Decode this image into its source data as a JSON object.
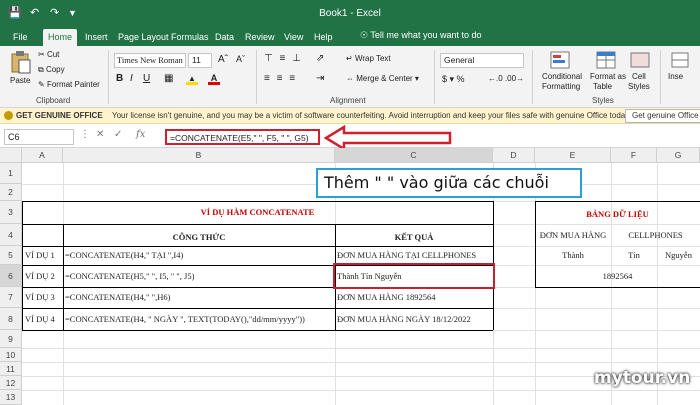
{
  "window": {
    "title": "Book1 - Excel"
  },
  "tabs": [
    "File",
    "Home",
    "Insert",
    "Page Layout",
    "Formulas",
    "Data",
    "Review",
    "View",
    "Help"
  ],
  "tell_me": "Tell me what you want to do",
  "ribbon": {
    "clipboard": {
      "paste": "Paste",
      "cut": "Cut",
      "copy": "Copy",
      "format_painter": "Format Painter",
      "label": "Clipboard"
    },
    "font": {
      "name": "Times New Roman",
      "size": "11",
      "bold": "B",
      "italic": "I",
      "underline": "U"
    },
    "alignment": {
      "wrap_text": "Wrap Text",
      "merge_center": "Merge & Center",
      "label": "Alignment"
    },
    "number": {
      "format": "General"
    },
    "styles": {
      "conditional": "Conditional",
      "formatting": "Formatting",
      "format_as": "Format as",
      "table": "Table",
      "cell": "Cell",
      "cell_styles": "Styles",
      "label": "Styles"
    },
    "cells": {
      "insert": "Inse",
      "label": ""
    }
  },
  "license_bar": {
    "title": "GET GENUINE OFFICE",
    "message": "Your license isn't genuine, and you may be a victim of software counterfeiting. Avoid interruption and keep your files safe with genuine Office today.",
    "button": "Get genuine Office"
  },
  "formula_bar": {
    "name_box": "C6",
    "fx": "fx",
    "formula": "=CONCATENATE(E5,\" \", F5, \" \", G5)"
  },
  "columns": [
    "A",
    "B",
    "C",
    "D",
    "E",
    "F",
    "G"
  ],
  "rows": [
    "1",
    "2",
    "3",
    "4",
    "5",
    "6",
    "7",
    "8",
    "9",
    "10",
    "11",
    "12",
    "13"
  ],
  "callout": "Thêm \" \" vào giữa các chuỗi",
  "sheet": {
    "main_title": "VÍ DỤ HÀM CONCATENATE",
    "header_formula": "CÔNG THỨC",
    "header_result": "KẾT QUẢ",
    "examples": [
      {
        "label": "VÍ DỤ 1",
        "formula": "=CONCATENATE(H4,\" TẠI \",I4)",
        "result": "ĐƠN MUA HÀNG TẠI CELLPHONES"
      },
      {
        "label": "VÍ DỤ 2",
        "formula": "=CONCATENATE(H5,\" \", I5, \" \", J5)",
        "result": "Thành Tín Nguyễn"
      },
      {
        "label": "VÍ DỤ 3",
        "formula": "=CONCATENATE(H4,\" \",H6)",
        "result": "ĐƠN MUA HÀNG 1892564"
      },
      {
        "label": "VÍ DỤ 4",
        "formula": "=CONCATENATE(H4, \" NGÀY \", TEXT(TODAY(),\"dd/mm/yyyy\"))",
        "result": "ĐƠN MUA HÀNG NGÀY 18/12/2022"
      }
    ],
    "data_table": {
      "title": "BẢNG DỮ LIỆU",
      "h1": "ĐƠN MUA HÀNG",
      "h2": "CELLPHONES",
      "r5": [
        "Thành",
        "Tín",
        "Nguyễn"
      ],
      "r6": "1892564"
    }
  },
  "watermark": "mytour.vn",
  "colors": {
    "excel_green": "#217346",
    "highlight_red": "#c8202f",
    "callout_blue": "#2e9fd6",
    "title_red": "#c00000"
  }
}
